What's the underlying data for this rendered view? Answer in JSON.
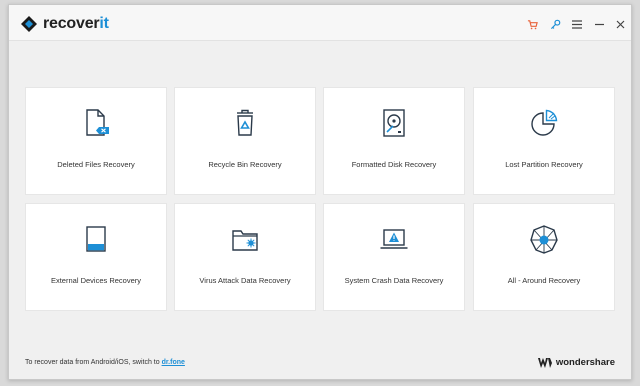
{
  "app": {
    "logo_main": "recover",
    "logo_accent": "it"
  },
  "titlebar": {
    "cart_icon": "cart-icon",
    "key_icon": "key-icon",
    "menu_icon": "menu-icon",
    "minimize_icon": "minimize-icon",
    "close_icon": "close-icon"
  },
  "cards": [
    {
      "label": "Deleted Files Recovery",
      "icon": "deleted-file-icon"
    },
    {
      "label": "Recycle Bin Recovery",
      "icon": "recycle-bin-icon"
    },
    {
      "label": "Formatted Disk Recovery",
      "icon": "hard-disk-icon"
    },
    {
      "label": "Lost Partition Recovery",
      "icon": "partition-icon"
    },
    {
      "label": "External Devices Recovery",
      "icon": "external-device-icon"
    },
    {
      "label": "Virus Attack Data Recovery",
      "icon": "virus-folder-icon"
    },
    {
      "label": "System Crash Data Recovery",
      "icon": "crash-laptop-icon"
    },
    {
      "label": "All - Around Recovery",
      "icon": "all-around-icon"
    }
  ],
  "footer": {
    "text": "To recover data from Android/iOS, switch to ",
    "link": "dr.fone",
    "brand": "wondershare"
  },
  "colors": {
    "accent": "#1d8fd6",
    "cart": "#e8643c",
    "icon_stroke": "#2b3a4a"
  }
}
